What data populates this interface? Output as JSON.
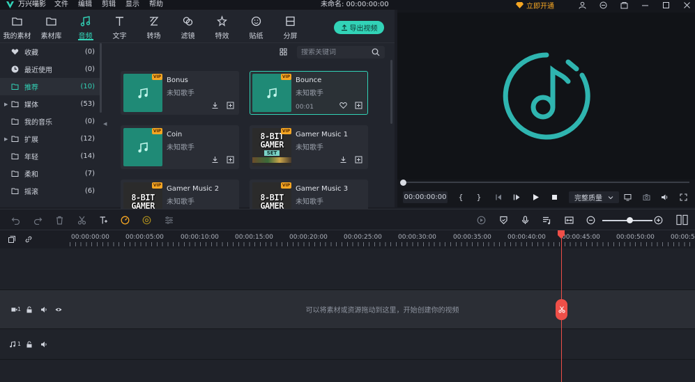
{
  "app": {
    "name": "万兴喵影",
    "menu": [
      "文件",
      "编辑",
      "剪辑",
      "显示",
      "帮助"
    ],
    "doc_title": "未命名: 00:00:00:00",
    "vip_label": "立即开通",
    "accent": "#32d3b7",
    "vip_color": "#f5a623"
  },
  "tabs": [
    {
      "label": "我的素材",
      "icon": "folder-icon"
    },
    {
      "label": "素材库",
      "icon": "folder-icon"
    },
    {
      "label": "音频",
      "icon": "music-note-icon",
      "active": true
    },
    {
      "label": "文字",
      "icon": "text-icon"
    },
    {
      "label": "转场",
      "icon": "transition-icon"
    },
    {
      "label": "滤镜",
      "icon": "filter-icon"
    },
    {
      "label": "特效",
      "icon": "effects-icon"
    },
    {
      "label": "贴纸",
      "icon": "sticker-icon"
    },
    {
      "label": "分屏",
      "icon": "split-screen-icon"
    }
  ],
  "export_label": "导出视频",
  "sidebar": [
    {
      "name": "收藏",
      "count": "(0)",
      "icon": "heart-icon"
    },
    {
      "name": "最近使用",
      "count": "(0)",
      "icon": "clock-icon"
    },
    {
      "name": "推荐",
      "count": "(10)",
      "icon": "folder-icon",
      "active": true
    },
    {
      "name": "媒体",
      "count": "(53)",
      "icon": "folder-icon",
      "expandable": true
    },
    {
      "name": "我的音乐",
      "count": "(0)",
      "icon": "folder-icon"
    },
    {
      "name": "扩展",
      "count": "(12)",
      "icon": "folder-icon",
      "expandable": true
    },
    {
      "name": "年轻",
      "count": "(14)",
      "icon": "folder-icon"
    },
    {
      "name": "柔和",
      "count": "(7)",
      "icon": "folder-icon"
    },
    {
      "name": "摇滚",
      "count": "(6)",
      "icon": "folder-icon"
    }
  ],
  "search": {
    "placeholder": "搜索关键词"
  },
  "cards": [
    {
      "title": "Bonus",
      "artist": "未知歌手",
      "vip": "VIP",
      "thumb": "music"
    },
    {
      "title": "Bounce",
      "artist": "未知歌手",
      "vip": "VIP",
      "thumb": "music",
      "duration": "00:01",
      "selected": true
    },
    {
      "title": "Coin",
      "artist": "未知歌手",
      "vip": "VIP",
      "thumb": "music"
    },
    {
      "title": "Gamer Music 1",
      "artist": "未知歌手",
      "vip": "VIP",
      "thumb": "pixel",
      "pixel_text": [
        "8-BIT",
        "GAMER"
      ],
      "pixel_sub": "SET"
    },
    {
      "title": "Gamer Music 2",
      "artist": "未知歌手",
      "vip": "VIP",
      "thumb": "pixel",
      "pixel_text": [
        "8-BIT",
        "GAMER"
      ]
    },
    {
      "title": "Gamer Music 3",
      "artist": "未知歌手",
      "vip": "VIP",
      "thumb": "pixel",
      "pixel_text": [
        "8-BIT",
        "GAMER"
      ]
    }
  ],
  "preview": {
    "timecode": "00:00:00:00",
    "quality": "完整质量",
    "bracket_in": "{",
    "bracket_out": "}",
    "progress": 0
  },
  "timeline": {
    "ticks": [
      "00:00:00:00",
      "00:00:05:00",
      "00:00:10:00",
      "00:00:15:00",
      "00:00:20:00",
      "00:00:25:00",
      "00:00:30:00",
      "00:00:35:00",
      "00:00:40:00",
      "00:00:45:00",
      "00:00:50:00",
      "00:00:5"
    ],
    "drop_hint": "可以将素材或资源拖动到这里，开始创建你的视频",
    "video_track_num": "1",
    "audio_track_num": "1",
    "playhead_color": "#ef4f48"
  }
}
